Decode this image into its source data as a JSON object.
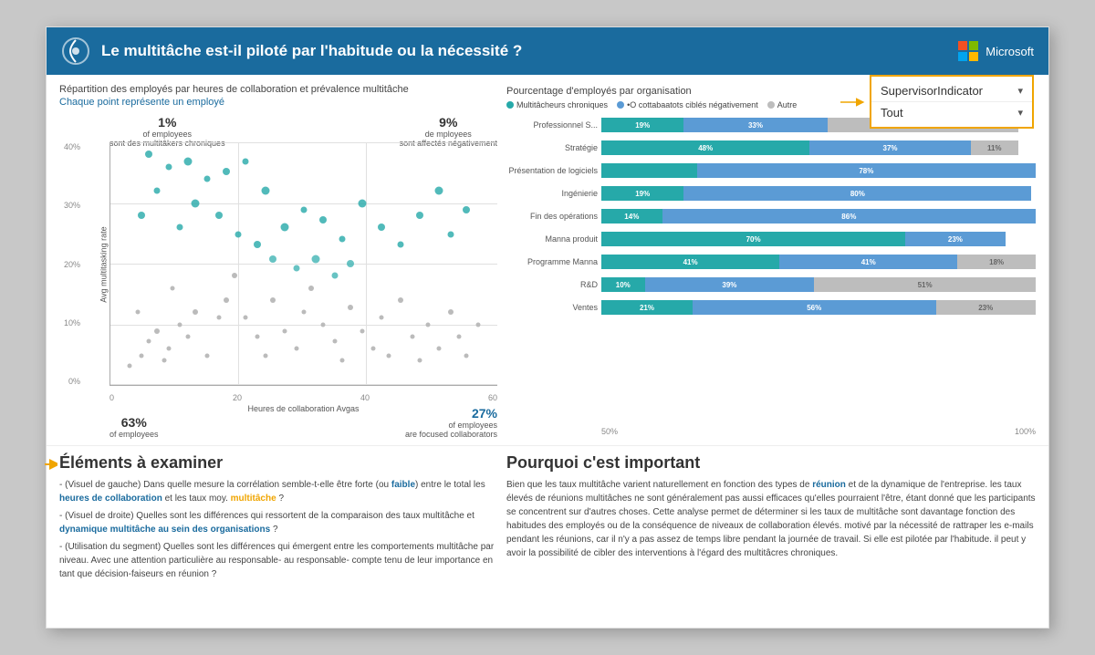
{
  "header": {
    "title": "Le multitâche est-il piloté par l'habitude ou la nécessité ?",
    "ms_label": "Microsoft"
  },
  "filters": {
    "label1": "SupervisorIndicator",
    "label2": "Tout"
  },
  "scatter": {
    "title": "Répartition des employés par heures de collaboration et prévalence multitâche",
    "subtitle": "Chaque point représente un employé",
    "y_label": "Avg multitasking rate",
    "x_label": "Heures de collaboration Avgas",
    "stat_tl_pct": "1%",
    "stat_tl_desc": "of employees",
    "stat_tl_sub": "sont des multitâkers chroniques",
    "stat_tr_pct": "9%",
    "stat_tr_desc": "de mployees",
    "stat_tr_sub": "sont affectés négativement",
    "stat_bl_pct": "63%",
    "stat_bl_desc": "of employees",
    "stat_br_pct": "27%",
    "stat_br_desc": "of employees",
    "stat_br_sub": "are focused collaborators",
    "y_ticks": [
      "40%",
      "30%",
      "20%",
      "10%",
      "0%"
    ],
    "x_ticks": [
      "0",
      "20",
      "40",
      "60"
    ]
  },
  "bar_chart": {
    "title": "Pourcentage d'employés par organisation",
    "legend": [
      {
        "label": "Multitâcheurs chroniques",
        "color": "#26a9a9"
      },
      {
        "label": "•O cottabaatots ciblés négativement",
        "color": "#5b9bd5"
      },
      {
        "label": "Autre",
        "color": "#bdbdbd"
      }
    ],
    "rows": [
      {
        "label": "Professionnel S...",
        "segments": [
          {
            "pct": 19,
            "color": "teal",
            "label": "19%"
          },
          {
            "pct": 33,
            "color": "blue",
            "label": "33%"
          },
          {
            "pct": 44,
            "color": "gray",
            "label": "44%"
          }
        ]
      },
      {
        "label": "Stratégie",
        "segments": [
          {
            "pct": 48,
            "color": "teal",
            "label": "48%"
          },
          {
            "pct": 37,
            "color": "blue",
            "label": "37%"
          },
          {
            "pct": 11,
            "color": "gray",
            "label": "11%"
          }
        ]
      },
      {
        "label": "Présentation de logiciels",
        "segments": [
          {
            "pct": 22,
            "color": "teal",
            "label": ""
          },
          {
            "pct": 78,
            "color": "blue",
            "label": "78%"
          },
          {
            "pct": 0,
            "color": "gray",
            "label": ""
          }
        ]
      },
      {
        "label": "Ingénierie",
        "segments": [
          {
            "pct": 19,
            "color": "teal",
            "label": "19%"
          },
          {
            "pct": 80,
            "color": "blue",
            "label": "80%"
          },
          {
            "pct": 0,
            "color": "gray",
            "label": ""
          }
        ]
      },
      {
        "label": "Fin des opérations",
        "segments": [
          {
            "pct": 14,
            "color": "teal",
            "label": "14%"
          },
          {
            "pct": 86,
            "color": "blue",
            "label": "86%"
          },
          {
            "pct": 0,
            "color": "gray",
            "label": ""
          }
        ]
      },
      {
        "label": "Manna produit",
        "segments": [
          {
            "pct": 70,
            "color": "teal",
            "label": "70%"
          },
          {
            "pct": 23,
            "color": "blue",
            "label": "23%"
          },
          {
            "pct": 0,
            "color": "gray",
            "label": ""
          }
        ]
      },
      {
        "label": "Programme Manna",
        "segments": [
          {
            "pct": 41,
            "color": "teal",
            "label": "41%"
          },
          {
            "pct": 41,
            "color": "blue",
            "label": "41%"
          },
          {
            "pct": 18,
            "color": "gray",
            "label": "18%"
          }
        ]
      },
      {
        "label": "R&D",
        "segments": [
          {
            "pct": 10,
            "color": "teal",
            "label": "10%"
          },
          {
            "pct": 39,
            "color": "blue",
            "label": "39%"
          },
          {
            "pct": 51,
            "color": "gray",
            "label": "51%"
          }
        ]
      },
      {
        "label": "Ventes",
        "segments": [
          {
            "pct": 21,
            "color": "teal",
            "label": "21%"
          },
          {
            "pct": 56,
            "color": "blue",
            "label": "56%"
          },
          {
            "pct": 23,
            "color": "gray",
            "label": "23%"
          }
        ]
      }
    ],
    "x_axis": [
      "50%",
      "100%"
    ]
  },
  "bottom": {
    "left_heading": "Éléments à examiner",
    "left_text": "- (Visuel de gauche) Dans quelle mesure la corrélation semble-t-elle être forte (ou faible) entre le total les heures de collaboration et les taux moy. multitâche ?\n- (Visuel de droite) Quelles sont les différences qui ressortent de la comparaison des taux multitâche et dynamique multitâche au sein des organisations ?\n- (Utilisation du segment) Quelles sont les différences qui émergent entre les comportements multitâche par niveau. Avec une attention particulière au responsable- au responsable- compte tenu de leur importance en tant que décision-faiseurs en réunion ?",
    "right_heading": "Pourquoi c'est important",
    "right_text": "Bien que les taux multitâche varient naturellement en fonction des types de réunion et de la dynamique de l'entreprise. les taux élevés de réunions multitâches ne sont généralement pas aussi efficaces qu'elles pourraient l'être, étant donné que les participants se concentrent sur d'autres choses. Cette analyse permet de déterminer si les taux de multitâche sont davantage fonction des habitudes des employés ou de la conséquence de niveaux de collaboration élevés. motivé par la nécessité de rattraper les e-mails pendant les réunions, car il n'y a pas assez de temps libre pendant la journée de travail. Si elle est pilotée par l'habitude. il peut y avoir la possibilité de cibler des interventions à l'égard des multitâcres chroniques."
  }
}
